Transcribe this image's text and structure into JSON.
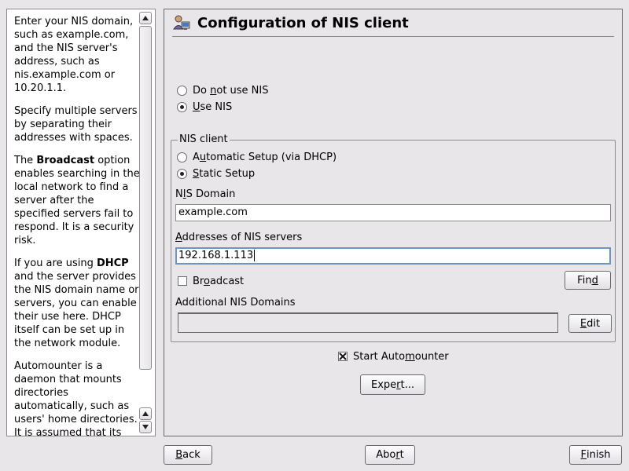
{
  "help": {
    "p1": "Enter your NIS domain, such as example.com, and the NIS server's address, such as nis.example.com or 10.20.1.1.",
    "p2": "Specify multiple servers by separating their addresses with spaces.",
    "p3_pre": "The ",
    "p3_bold": "Broadcast",
    "p3_post": " option enables searching in the local network to find a server after the specified servers fail to respond. It is a security risk.",
    "p4_pre": "If you are using ",
    "p4_bold": "DHCP",
    "p4_post": " and the server provides the NIS domain name or servers, you can enable their use here. DHCP itself can be set up in the network module.",
    "p5": "Automounter is a daemon that mounts directories automatically, such as users' home directories. It is assumed that its configuration"
  },
  "header": {
    "title": "Configuration of NIS client",
    "icon": "nis-client-icon"
  },
  "use_nis": {
    "option_no_pre": "Do ",
    "option_no_ul": "n",
    "option_no_post": "ot use NIS",
    "option_yes_ul": "U",
    "option_yes_post": "se NIS",
    "selected": "Use NIS"
  },
  "nis_client": {
    "group_title": "NIS client",
    "auto_pre": "A",
    "auto_ul": "u",
    "auto_post": "tomatic Setup (via DHCP)",
    "static_ul": "S",
    "static_post": "tatic Setup",
    "selected": "Static Setup",
    "domain_label_pre": "N",
    "domain_label_ul": "I",
    "domain_label_post": "S Domain",
    "domain_value": "example.com",
    "servers_label_ul": "A",
    "servers_label_post": "ddresses of NIS servers",
    "servers_value": "192.168.1.113",
    "broadcast_pre": "Br",
    "broadcast_ul": "o",
    "broadcast_post": "adcast",
    "broadcast_checked": false,
    "find_pre": "Fin",
    "find_ul": "d",
    "find_post": "",
    "additional_label": "Additional NIS Domains",
    "additional_value": "",
    "edit_ul": "E",
    "edit_post": "dit"
  },
  "automounter": {
    "label_pre": "Start Auto",
    "label_ul": "m",
    "label_post": "ounter",
    "checked": true
  },
  "expert_button": {
    "pre": "Expe",
    "ul": "r",
    "post": "t..."
  },
  "footer": {
    "back_ul": "B",
    "back_post": "ack",
    "abort_pre": "Abo",
    "abort_ul": "r",
    "abort_post": "t",
    "finish_ul": "F",
    "finish_post": "inish"
  }
}
